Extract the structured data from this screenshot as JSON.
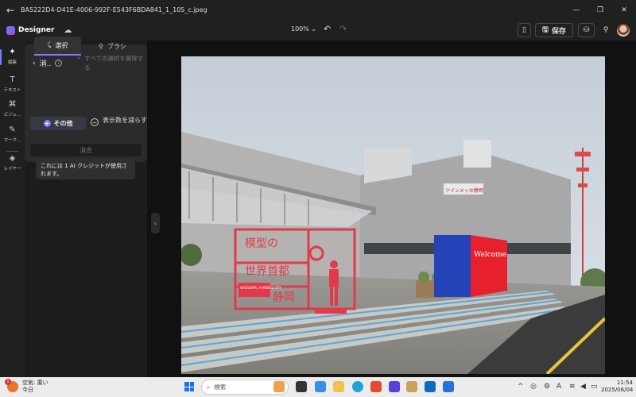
{
  "window": {
    "title": "BA5222D4-D41E-4006-992F-E543F6BDA841_1_105_c.jpeg",
    "minimize_glyph": "—",
    "maximize_glyph": "❐",
    "close_glyph": "✕",
    "back_glyph": "←"
  },
  "app": {
    "name": "Designer",
    "zoom": "100%",
    "save_label": "保存"
  },
  "rail": {
    "items": [
      {
        "label": "編集",
        "icon": "sparkle-icon",
        "glyph": "✦"
      },
      {
        "label": "テキスト",
        "icon": "text-icon",
        "glyph": "T"
      },
      {
        "label": "ビジュ...",
        "icon": "shapes-icon",
        "glyph": "⌘"
      },
      {
        "label": "マーク...",
        "icon": "pen-icon",
        "glyph": "✎"
      },
      {
        "label": "レイヤー",
        "icon": "layers-icon",
        "glyph": "◈"
      }
    ]
  },
  "panel": {
    "title": "消..",
    "deselect_all": "すべての選択を解除する",
    "tabs": [
      {
        "label": "選択",
        "icon": "select-icon"
      },
      {
        "label": "ブラシ",
        "icon": "brush-icon"
      }
    ],
    "chip_label": "その他",
    "reduce_label": "表示数を減らす",
    "erase_label": "消去"
  },
  "tooltip": "これには 1 AI クレジットが使用されます。",
  "photo": {
    "sign_main": "ツインメッセ静岡",
    "welcome": "Welcome",
    "frame_line1": "模型の",
    "frame_line2": "世界首都",
    "frame_line3": "静岡",
    "frame_small": "SHIZUOKA, A MODEL CITY"
  },
  "taskbar": {
    "weather_text": "空気: 悪い",
    "weather_sub": "今日",
    "weather_badge": "1",
    "search_placeholder": "検索",
    "time": "11:54",
    "date": "2025/06/04",
    "tray_arrow": "^",
    "tray_lang": "A"
  }
}
